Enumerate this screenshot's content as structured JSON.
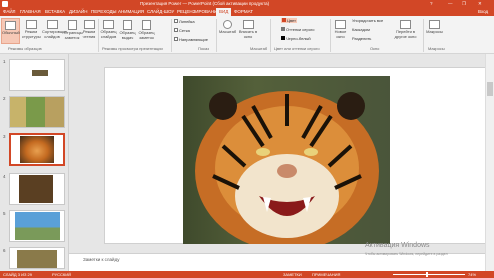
{
  "window": {
    "title": "Презентация Power — PowerPoint (Сбой активации продукта)",
    "help": "?",
    "user": "Вход",
    "controls": [
      "—",
      "❐",
      "✕"
    ]
  },
  "tabs": [
    {
      "label": "ФАЙЛ",
      "active": false
    },
    {
      "label": "ГЛАВНАЯ",
      "active": false
    },
    {
      "label": "ВСТАВКА",
      "active": false
    },
    {
      "label": "ДИЗАЙН",
      "active": false
    },
    {
      "label": "ПЕРЕХОДЫ",
      "active": false
    },
    {
      "label": "АНИМАЦИЯ",
      "active": false
    },
    {
      "label": "СЛАЙД-ШОУ",
      "active": false
    },
    {
      "label": "РЕЦЕНЗИРОВАНИЕ",
      "active": false
    },
    {
      "label": "ВИД",
      "active": false
    },
    {
      "label": "ФОРМАТ",
      "active": true
    }
  ],
  "ribbon": {
    "groups": [
      {
        "label": "Режимы образцов"
      },
      {
        "label": "Режимы просмотра презентации"
      },
      {
        "label": "Показ"
      },
      {
        "label": "Масштаб"
      },
      {
        "label": "Цвет или оттенки серого"
      },
      {
        "label": "Окно"
      },
      {
        "label": "Макросы"
      }
    ],
    "buttons": {
      "normal": "Обычный",
      "outline": "Режим структуры",
      "sorter": "Сортировщик слайдов",
      "notes_page": "Страницы заметок",
      "reading": "Режим чтения",
      "slide_master": "Образец слайдов",
      "handout_master": "Образец выдач",
      "notes_master": "Образец заметок",
      "zoom": "Масштаб",
      "fit": "Вписать в окно",
      "new_window": "Новое окно",
      "switch_windows": "Перейти в другое окно",
      "macros": "Макросы"
    },
    "checks": {
      "ruler": "Линейка",
      "grid": "Сетка",
      "guides": "Направляющие"
    },
    "color": {
      "color": "Цвет",
      "grayscale": "Оттенки серого",
      "bw": "Черно-белый"
    },
    "window_opts": {
      "arrange": "Упорядочить все",
      "cascade": "Каскадом",
      "split": "Разделить"
    }
  },
  "slides": [
    {
      "num": "1"
    },
    {
      "num": "2"
    },
    {
      "num": "3"
    },
    {
      "num": "4"
    },
    {
      "num": "5"
    },
    {
      "num": "6"
    }
  ],
  "notes_placeholder": "Заметки к слайду",
  "watermark": {
    "title": "Активация Windows",
    "sub": "Чтобы активировать Windows, перейдите в раздел"
  },
  "status": {
    "slide": "СЛАЙД 3 ИЗ 29",
    "lang": "РУССКИЙ",
    "notes": "ЗАМЕТКИ",
    "comments": "ПРИМЕЧАНИЯ",
    "zoom": "74%"
  },
  "colors": {
    "accent": "#d24726",
    "ribbon": "#f3f3f3",
    "bg": "#e6e6e6"
  }
}
